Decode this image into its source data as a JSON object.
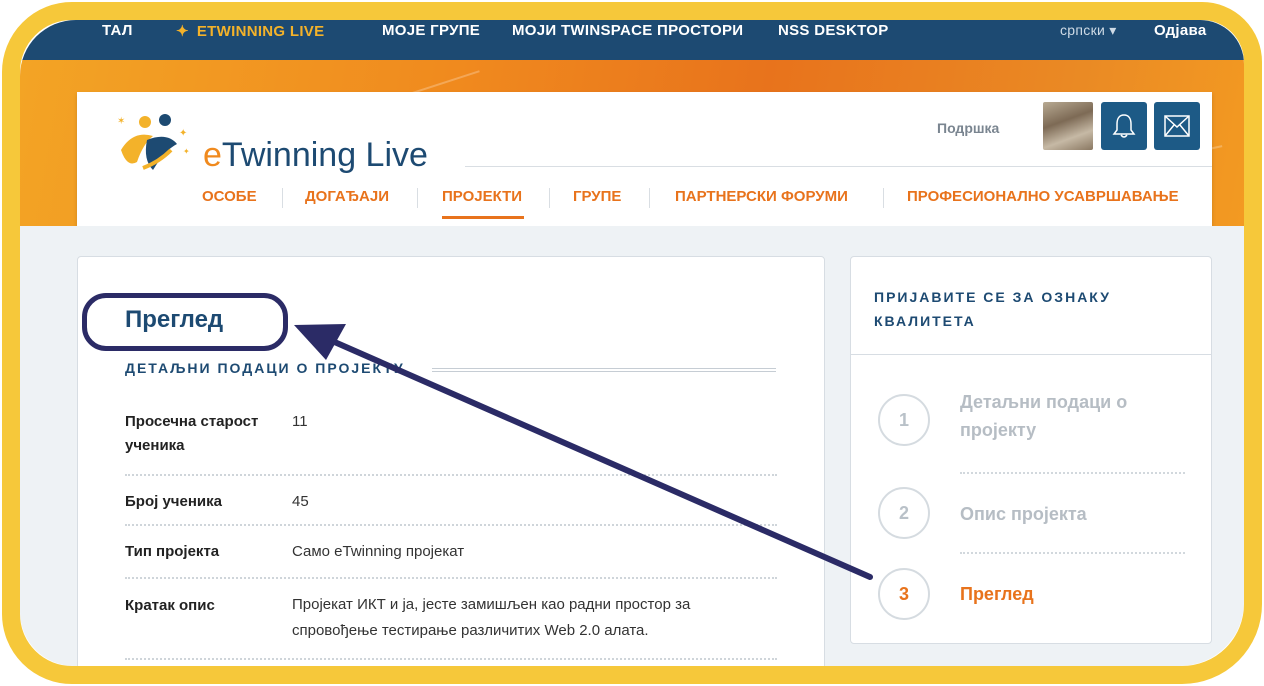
{
  "topbar": {
    "items": [
      "ТАЛ",
      "ETWINNING LIVE",
      "МОЈЕ ГРУПЕ",
      "МОЈИ TWINSPACE ПРОСТОРИ",
      "NSS DESKTOP"
    ],
    "language": "српски ▾",
    "logout": "Одјава"
  },
  "header": {
    "logo_e": "e",
    "logo_rest": "Twinning Live",
    "support": "Подршка"
  },
  "mainnav": {
    "items": [
      "ОСОБЕ",
      "ДОГАЂАЈИ",
      "ПРОЈЕКТИ",
      "ГРУПЕ",
      "ПАРТНЕРСКИ ФОРУМИ",
      "ПРОФЕСИОНАЛНО УСАВРШАВАЊЕ"
    ],
    "active": "ПРОЈЕКТИ"
  },
  "main": {
    "title": "Преглед",
    "section_heading": "ДЕТАЉНИ ПОДАЦИ О ПРОЈЕКТУ",
    "rows": [
      {
        "label": "Просечна старост ученика",
        "value": "11"
      },
      {
        "label": "Број ученика",
        "value": "45"
      },
      {
        "label": "Тип пројекта",
        "value": "Само eTwinning пројекат"
      },
      {
        "label": "Кратак опис",
        "value": "Пројекат ИКТ и ја, јесте замишљен као радни простор за спровођење тестирање различитих Web 2.0 алата."
      }
    ]
  },
  "sidebar": {
    "heading": "ПРИЈАВИТЕ СЕ ЗА ОЗНАКУ КВАЛИТЕТА",
    "steps": [
      {
        "number": "1",
        "label": "Детаљни подаци о пројекту"
      },
      {
        "number": "2",
        "label": "Опис пројекта"
      },
      {
        "number": "3",
        "label": "Преглед"
      }
    ],
    "active_step": "3"
  },
  "colors": {
    "frame": "#f6c83a",
    "navy": "#1d4a72",
    "orange": "#e8731c",
    "annotation": "#2b2b66"
  }
}
